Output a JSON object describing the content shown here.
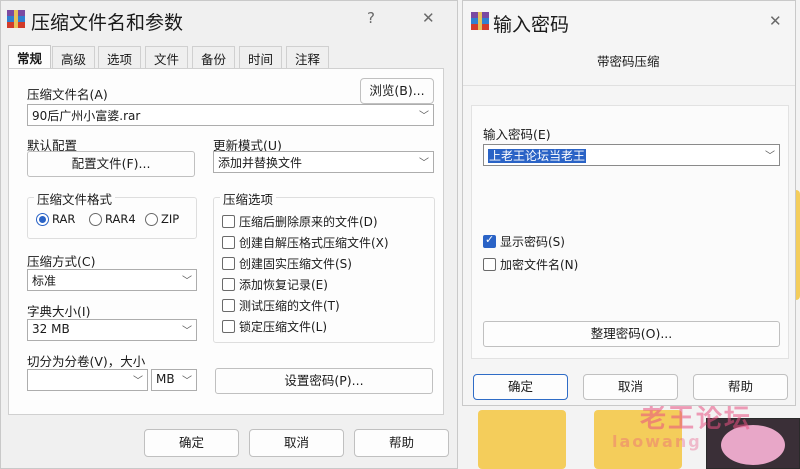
{
  "main_dialog": {
    "title": "压缩文件名和参数",
    "help_glyph": "?",
    "close_glyph": "✕",
    "tabs": [
      "常规",
      "高级",
      "选项",
      "文件",
      "备份",
      "时间",
      "注释"
    ],
    "archive_name_label": "压缩文件名(A)",
    "browse_button": "浏览(B)...",
    "archive_name_value": "90后广州小富婆.rar",
    "default_profile_label": "默认配置",
    "profile_button": "配置文件(F)...",
    "update_mode_label": "更新模式(U)",
    "update_mode_value": "添加并替换文件",
    "format_group_title": "压缩文件格式",
    "formats": [
      "RAR",
      "RAR4",
      "ZIP"
    ],
    "selected_format": "RAR",
    "method_label": "压缩方式(C)",
    "method_value": "标准",
    "dict_label": "字典大小(I)",
    "dict_value": "32 MB",
    "split_label": "切分为分卷(V)，大小",
    "split_value": "",
    "split_unit": "MB",
    "options_group_title": "压缩选项",
    "options": [
      {
        "label": "压缩后删除原来的文件(D)",
        "checked": false
      },
      {
        "label": "创建自解压格式压缩文件(X)",
        "checked": false
      },
      {
        "label": "创建固实压缩文件(S)",
        "checked": false
      },
      {
        "label": "添加恢复记录(E)",
        "checked": false
      },
      {
        "label": "测试压缩的文件(T)",
        "checked": false
      },
      {
        "label": "锁定压缩文件(L)",
        "checked": false
      }
    ],
    "set_password_button": "设置密码(P)...",
    "ok_button": "确定",
    "cancel_button": "取消",
    "help_button": "帮助"
  },
  "password_dialog": {
    "title": "输入密码",
    "close_glyph": "✕",
    "subtitle": "带密码压缩",
    "password_label": "输入密码(E)",
    "password_value": "上老王论坛当老王",
    "show_password": {
      "label": "显示密码(S)",
      "checked": true
    },
    "encrypt_names": {
      "label": "加密文件名(N)",
      "checked": false
    },
    "organize_button": "整理密码(O)...",
    "ok_button": "确定",
    "cancel_button": "取消",
    "help_button": "帮助"
  },
  "desktop": {
    "watermark": "老王论坛",
    "watermark_sub": "laowang"
  },
  "colors": {
    "accent": "#2a63c6",
    "folder": "#f4cd5b"
  }
}
